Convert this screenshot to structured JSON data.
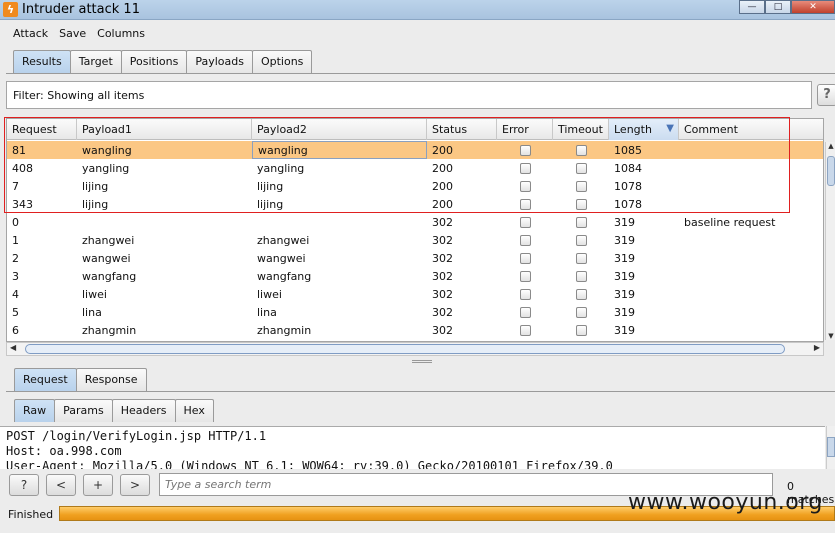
{
  "window": {
    "title": "Intruder attack 11",
    "controls": [
      "—",
      "□",
      "✕"
    ]
  },
  "menu": [
    "Attack",
    "Save",
    "Columns"
  ],
  "main_tabs": [
    {
      "label": "Results",
      "active": true
    },
    {
      "label": "Target",
      "active": false
    },
    {
      "label": "Positions",
      "active": false
    },
    {
      "label": "Payloads",
      "active": false
    },
    {
      "label": "Options",
      "active": false
    }
  ],
  "filter": {
    "text": "Filter:  Showing all items",
    "help": "?"
  },
  "table": {
    "columns": [
      "Request",
      "Payload1",
      "Payload2",
      "Status",
      "Error",
      "Timeout",
      "Length",
      "Comment"
    ],
    "sorted_column": "Length",
    "sort_direction": "descending",
    "rows": [
      {
        "request": "81",
        "payload1": "wangling",
        "payload2": "wangling",
        "status": "200",
        "error": false,
        "timeout": false,
        "length": "1085",
        "comment": "",
        "selected": true
      },
      {
        "request": "408",
        "payload1": "yangling",
        "payload2": "yangling",
        "status": "200",
        "error": false,
        "timeout": false,
        "length": "1084",
        "comment": "",
        "selected": false
      },
      {
        "request": "7",
        "payload1": "lijing",
        "payload2": "lijing",
        "status": "200",
        "error": false,
        "timeout": false,
        "length": "1078",
        "comment": "",
        "selected": false
      },
      {
        "request": "343",
        "payload1": "lijing",
        "payload2": "lijing",
        "status": "200",
        "error": false,
        "timeout": false,
        "length": "1078",
        "comment": "",
        "selected": false
      },
      {
        "request": "0",
        "payload1": "",
        "payload2": "",
        "status": "302",
        "error": false,
        "timeout": false,
        "length": "319",
        "comment": "baseline request",
        "selected": false
      },
      {
        "request": "1",
        "payload1": "zhangwei",
        "payload2": "zhangwei",
        "status": "302",
        "error": false,
        "timeout": false,
        "length": "319",
        "comment": "",
        "selected": false
      },
      {
        "request": "2",
        "payload1": "wangwei",
        "payload2": "wangwei",
        "status": "302",
        "error": false,
        "timeout": false,
        "length": "319",
        "comment": "",
        "selected": false
      },
      {
        "request": "3",
        "payload1": "wangfang",
        "payload2": "wangfang",
        "status": "302",
        "error": false,
        "timeout": false,
        "length": "319",
        "comment": "",
        "selected": false
      },
      {
        "request": "4",
        "payload1": "liwei",
        "payload2": "liwei",
        "status": "302",
        "error": false,
        "timeout": false,
        "length": "319",
        "comment": "",
        "selected": false
      },
      {
        "request": "5",
        "payload1": "lina",
        "payload2": "lina",
        "status": "302",
        "error": false,
        "timeout": false,
        "length": "319",
        "comment": "",
        "selected": false
      },
      {
        "request": "6",
        "payload1": "zhangmin",
        "payload2": "zhangmin",
        "status": "302",
        "error": false,
        "timeout": false,
        "length": "319",
        "comment": "",
        "selected": false
      }
    ]
  },
  "detail_tabs": [
    {
      "label": "Request",
      "active": true
    },
    {
      "label": "Response",
      "active": false
    }
  ],
  "view_tabs": [
    {
      "label": "Raw",
      "active": true
    },
    {
      "label": "Params",
      "active": false
    },
    {
      "label": "Headers",
      "active": false
    },
    {
      "label": "Hex",
      "active": false
    }
  ],
  "raw_lines": [
    "POST /login/VerifyLogin.jsp HTTP/1.1",
    "Host: oa.998.com",
    "User-Agent: Mozilla/5.0 (Windows NT 6.1; WOW64; rv:39.0) Gecko/20100101 Firefox/39.0"
  ],
  "search": {
    "help": "?",
    "prev": "<",
    "add": "+",
    "next": ">",
    "placeholder": "Type a search term",
    "matches": "0 matches"
  },
  "status": {
    "label": "Finished",
    "progress": 1.0
  },
  "watermark": "www.wooyun.org",
  "colors": {
    "selected_row": "#fbc784",
    "progress": "#f0a020",
    "highlight_box": "#e02020"
  }
}
